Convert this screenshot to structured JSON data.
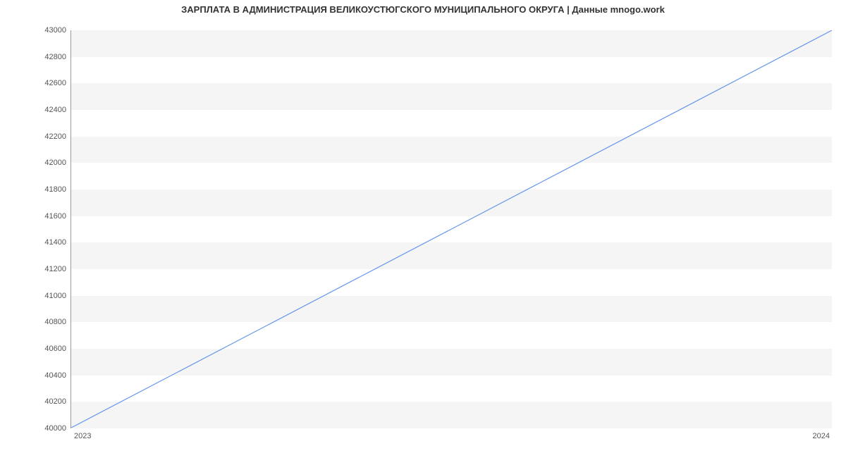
{
  "chart_data": {
    "type": "line",
    "title": "ЗАРПЛАТА В АДМИНИСТРАЦИЯ ВЕЛИКОУСТЮГСКОГО МУНИЦИПАЛЬНОГО ОКРУГА | Данные mnogo.work",
    "x": [
      2023,
      2024
    ],
    "values": [
      40000,
      43000
    ],
    "xlabel": "",
    "ylabel": "",
    "y_ticks": [
      40000,
      40200,
      40400,
      40600,
      40800,
      41000,
      41200,
      41400,
      41600,
      41800,
      42000,
      42200,
      42400,
      42600,
      42800,
      43000
    ],
    "x_ticks": [
      "2023",
      "2024"
    ],
    "ylim": [
      40000,
      43000
    ],
    "line_color": "#6495ED"
  }
}
